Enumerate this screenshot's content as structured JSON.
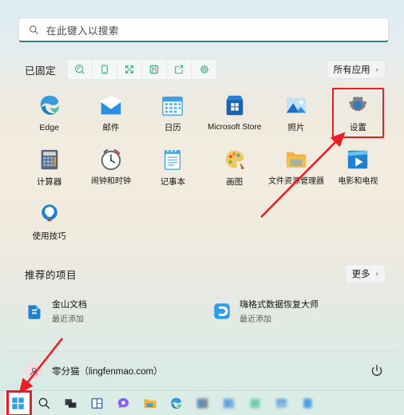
{
  "search": {
    "placeholder": "在此键入以搜索",
    "icon": "search-icon"
  },
  "pinned": {
    "title": "已固定",
    "all_apps_label": "所有应用",
    "chevron": "›",
    "toolbar_icons": [
      {
        "name": "search-tool-icon",
        "label": "搜索"
      },
      {
        "name": "device-tool-icon",
        "label": "设备"
      },
      {
        "name": "expand-tool-icon",
        "label": "全屏"
      },
      {
        "name": "save-tool-icon",
        "label": "保存"
      },
      {
        "name": "share-tool-icon",
        "label": "分享"
      },
      {
        "name": "settings-tool-icon",
        "label": "设置"
      }
    ],
    "apps": [
      {
        "label": "Edge",
        "icon": "edge-icon",
        "highlighted": false
      },
      {
        "label": "邮件",
        "icon": "mail-icon",
        "highlighted": false
      },
      {
        "label": "日历",
        "icon": "calendar-icon",
        "highlighted": false
      },
      {
        "label": "Microsoft Store",
        "icon": "store-icon",
        "highlighted": false
      },
      {
        "label": "照片",
        "icon": "photos-icon",
        "highlighted": false
      },
      {
        "label": "设置",
        "icon": "settings-gear-icon",
        "highlighted": true
      },
      {
        "label": "计算器",
        "icon": "calculator-icon",
        "highlighted": false
      },
      {
        "label": "闹钟和时钟",
        "icon": "clock-icon",
        "highlighted": false
      },
      {
        "label": "记事本",
        "icon": "notepad-icon",
        "highlighted": false
      },
      {
        "label": "画图",
        "icon": "paint-icon",
        "highlighted": false
      },
      {
        "label": "文件资源管理器",
        "icon": "file-explorer-icon",
        "highlighted": false
      },
      {
        "label": "电影和电视",
        "icon": "movies-tv-icon",
        "highlighted": false
      },
      {
        "label": "使用技巧",
        "icon": "tips-icon",
        "highlighted": false
      }
    ]
  },
  "recommended": {
    "title": "推荐的项目",
    "more_label": "更多",
    "chevron": "›",
    "items": [
      {
        "title": "金山文档",
        "subtitle": "最近添加",
        "icon": "wps-doc-icon"
      },
      {
        "title": "嗨格式数据恢复大师",
        "subtitle": "最近添加",
        "icon": "data-recovery-icon"
      }
    ]
  },
  "user": {
    "name": "零分猫（lingfenmao.com）",
    "avatar_icon": "person-icon",
    "power_icon": "power-icon"
  },
  "taskbar": {
    "items": [
      {
        "name": "start-button",
        "icon": "windows-logo-icon",
        "highlighted": true
      },
      {
        "name": "taskbar-search",
        "icon": "search-icon",
        "highlighted": false
      },
      {
        "name": "taskbar-task-view",
        "icon": "task-view-icon",
        "highlighted": false
      },
      {
        "name": "taskbar-widgets",
        "icon": "widgets-icon",
        "highlighted": false
      },
      {
        "name": "taskbar-chat",
        "icon": "chat-icon",
        "highlighted": false
      },
      {
        "name": "taskbar-file-explorer",
        "icon": "folder-icon",
        "highlighted": false
      },
      {
        "name": "taskbar-edge",
        "icon": "edge-icon",
        "highlighted": false
      },
      {
        "name": "taskbar-app-7",
        "icon": "app-icon",
        "highlighted": false
      },
      {
        "name": "taskbar-app-8",
        "icon": "app-icon",
        "highlighted": false
      },
      {
        "name": "taskbar-app-9",
        "icon": "app-icon",
        "highlighted": false
      },
      {
        "name": "taskbar-app-10",
        "icon": "app-icon",
        "highlighted": false
      },
      {
        "name": "taskbar-app-11",
        "icon": "app-icon",
        "highlighted": false
      }
    ]
  },
  "annotations": {
    "highlight_color": "#ee1c24",
    "arrows": [
      {
        "name": "arrow-to-settings",
        "points_to": "设置"
      },
      {
        "name": "arrow-to-start-button",
        "points_to": "start-button"
      }
    ]
  }
}
